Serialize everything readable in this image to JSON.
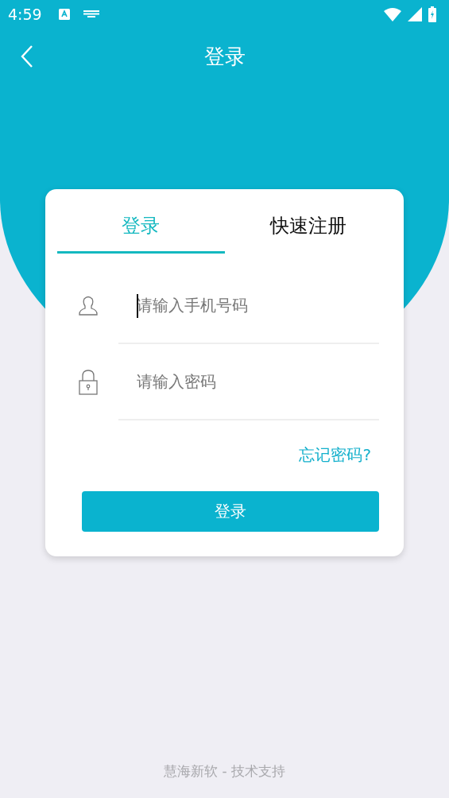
{
  "status_bar": {
    "time": "4:59"
  },
  "header": {
    "title": "登录"
  },
  "tabs": [
    {
      "label": "登录",
      "selected": true
    },
    {
      "label": "快速注册",
      "selected": false
    }
  ],
  "fields": [
    {
      "kind": "user",
      "placeholder": "请输入手机号码",
      "focused": true
    },
    {
      "kind": "password",
      "placeholder": "请输入密码",
      "focused": false
    }
  ],
  "forgot_link": "忘记密码?",
  "login_button": "登录",
  "footer": "慧海新软 - 技术支持"
}
